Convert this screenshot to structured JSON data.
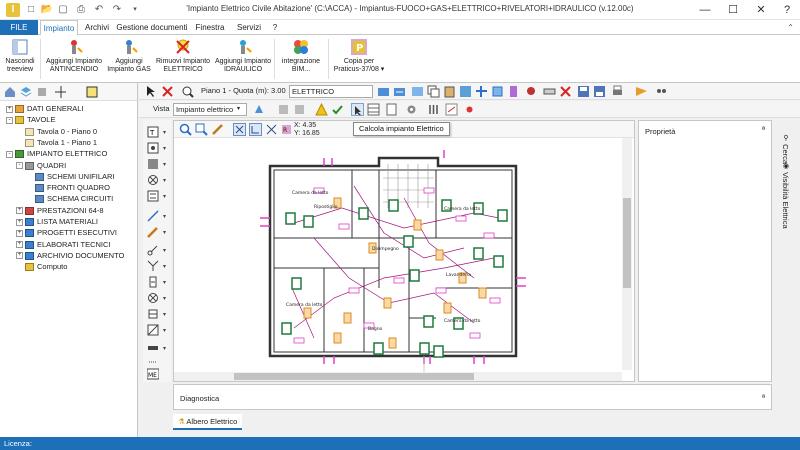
{
  "window": {
    "title": "'Impianto Elettrico Civile Abitazione' (C:\\ACCA) - Impiantus-FUOCO+GAS+ELETTRICO+RIVELATORI+IDRAULICO (v.12.00c)",
    "minimize": "—",
    "maximize": "☐",
    "close": "✕",
    "help": "?"
  },
  "quick_access": [
    "new-icon",
    "open-icon",
    "save-icon",
    "print-icon",
    "undo-icon",
    "redo-icon",
    "customize-icon"
  ],
  "ribbon_tabs": [
    {
      "label": "FILE"
    },
    {
      "label": "Impianto"
    },
    {
      "label": "Archivi"
    },
    {
      "label": "Gestione documenti"
    },
    {
      "label": "Finestra"
    },
    {
      "label": "Servizi"
    },
    {
      "label": "?"
    }
  ],
  "ribbon_buttons": [
    {
      "label": "Nascondi\ntreeview"
    },
    {
      "label": "Aggiungi Impianto\nANTINCENDIO"
    },
    {
      "label": "Aggiungi\nImpianto GAS"
    },
    {
      "label": "Rimuovi Impianto\nELETTRICO"
    },
    {
      "label": "Aggiungi Impianto\nIDRAULICO"
    },
    {
      "label": "integrazione\nBIM..."
    },
    {
      "label": "Copia per\nPraticus-37/08 ▾"
    }
  ],
  "tree": [
    {
      "label": "DATI GENERALI",
      "level": 0,
      "expander": "+"
    },
    {
      "label": "TAVOLE",
      "level": 0,
      "expander": "-"
    },
    {
      "label": "Tavola 0 - Piano 0",
      "level": 1,
      "expander": ""
    },
    {
      "label": "Tavola 1 - Piano 1",
      "level": 1,
      "expander": ""
    },
    {
      "label": "IMPIANTO ELETTRICO",
      "level": 0,
      "expander": "-"
    },
    {
      "label": "QUADRI",
      "level": 1,
      "expander": "-"
    },
    {
      "label": "SCHEMI UNIFILARI",
      "level": 2,
      "expander": ""
    },
    {
      "label": "FRONTI QUADRO",
      "level": 2,
      "expander": ""
    },
    {
      "label": "SCHEMA CIRCUITI",
      "level": 2,
      "expander": ""
    },
    {
      "label": "PRESTAZIONI 64-8",
      "level": 1,
      "expander": "+"
    },
    {
      "label": "LISTA MATERIALI",
      "level": 1,
      "expander": "+"
    },
    {
      "label": "PROGETTI ESECUTIVI",
      "level": 1,
      "expander": "+"
    },
    {
      "label": "ELABORATI TECNICI",
      "level": 1,
      "expander": "+"
    },
    {
      "label": "ARCHIVIO DOCUMENTO",
      "level": 1,
      "expander": "+"
    },
    {
      "label": "Computo",
      "level": 1,
      "expander": ""
    }
  ],
  "toolbar2": {
    "vista_label": "Vista",
    "vista_value": "Impianto elettrico",
    "piano_label": "Piano 1 - Quota (m): 3.00",
    "layer_value": "ELETTRICO"
  },
  "canvas": {
    "coord_x": "X: 4.35",
    "coord_y": "Y: 16.85",
    "tooltip": "Calcola impianto Elettrico",
    "rooms": [
      "Camera da letto",
      "Ripostiglio",
      "Camera da letto",
      "Disimpegno",
      "Lavanderia",
      "Camera da letto",
      "Bagno",
      "Camera da letto"
    ]
  },
  "panels": {
    "properties_title": "Proprietà",
    "properties_pin": "ª",
    "diagnostics_title": "Diagnostica",
    "diagnostics_pin": "ª",
    "side_tabs": [
      "Cerca",
      "Visibilità Elettrica"
    ],
    "bottom_tab": "Albero Elettrico"
  },
  "status": {
    "licenza": "Licenza:"
  },
  "colors": {
    "accent": "#1d6fb8",
    "wall": "#333333",
    "wire": "#a0157a",
    "magenta_marks": "#e040c8",
    "component_green": "#1f7a3a",
    "component_orange": "#e08a1e"
  }
}
